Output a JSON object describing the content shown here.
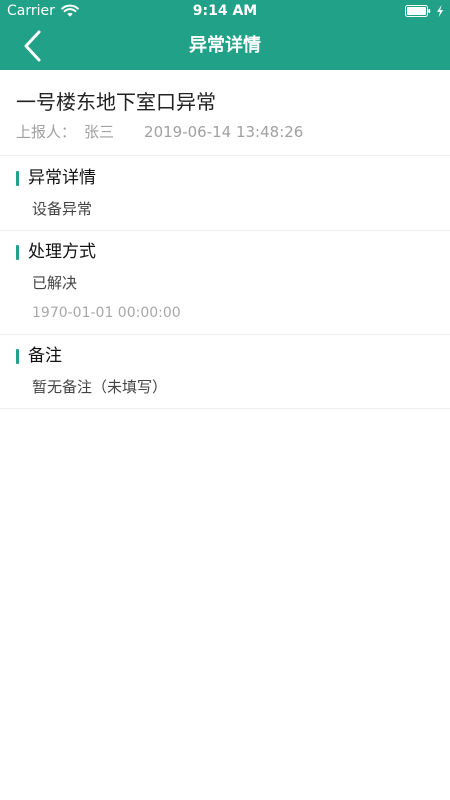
{
  "status_bar": {
    "carrier": "Carrier",
    "time": "9:14 AM",
    "icons": {
      "wifi": "wifi-icon",
      "battery": "battery-icon",
      "charging": "bolt-icon"
    }
  },
  "nav": {
    "title": "异常详情",
    "back_icon": "back-icon"
  },
  "report": {
    "title": "一号楼东地下室口异常",
    "reporter_label": "上报人：",
    "reporter_name": "张三",
    "report_time": "2019-06-14 13:48:26"
  },
  "sections": {
    "detail": {
      "title": "异常详情",
      "value": "设备异常"
    },
    "handling": {
      "title": "处理方式",
      "value": "已解决",
      "time": "1970-01-01 00:00:00"
    },
    "remark": {
      "title": "备注",
      "value": "暂无备注（未填写）"
    }
  },
  "colors": {
    "primary": "#21a288",
    "text_primary": "#222222",
    "text_secondary": "#a0a0a0",
    "divider": "#eeeeee"
  }
}
